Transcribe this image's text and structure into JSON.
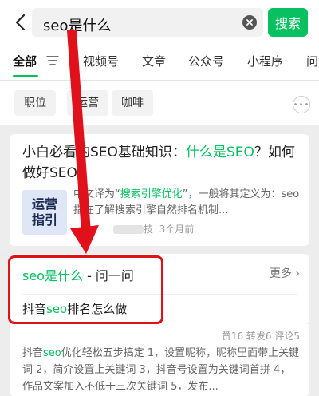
{
  "search": {
    "query": "seo是什么",
    "button_label": "搜索"
  },
  "tabs": [
    "全部",
    "视频号",
    "文章",
    "公众号",
    "小程序",
    "问一"
  ],
  "chips": [
    "职位",
    "运营",
    "咖啡"
  ],
  "article": {
    "title_parts": [
      "小白必看的SEO基础知识：",
      "什么是SEO",
      "？如何做好SEO?"
    ],
    "thumb_lines": [
      "运营",
      "指引"
    ],
    "snippet_parts": [
      "中文译为“",
      "搜索引擎优化",
      "”，一般将其定义为：seo指在了解搜索引擎自然排名机制..."
    ],
    "meta_source_tail": "技",
    "meta_time": "3个月前"
  },
  "wenwen": {
    "title_highlight": "seo是什么",
    "title_rest": " - 问一问",
    "more_label": "更多",
    "question_parts": [
      "抖音",
      "seo",
      "排名怎么做"
    ]
  },
  "answer": {
    "stats": "赞16 转发6 评论5",
    "text_parts": [
      "抖音",
      "seo",
      "优化轻松五步搞定 1，设置昵称，昵称里面带上关键词 2，简介设置上关键词 3，抖音号设置为关键词首拼 4，作品文案加入不低于三次关键词 5，发布..."
    ]
  },
  "colors": {
    "accent": "#07c160",
    "annotation": "#e0111b"
  }
}
